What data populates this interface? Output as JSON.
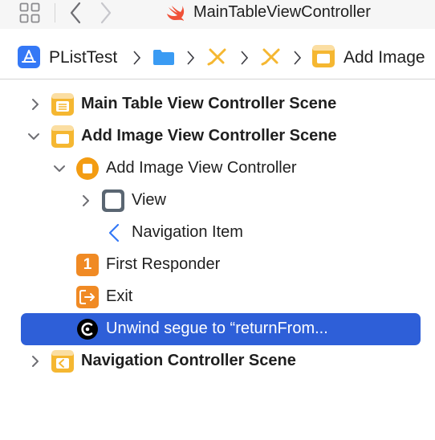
{
  "toolbar": {
    "file_tab_title": "MainTableViewController"
  },
  "breadcrumb": {
    "project": "PListTest",
    "last": "Add Image"
  },
  "outline": {
    "rows": [
      {
        "label": "Main Table View Controller Scene"
      },
      {
        "label": "Add Image View Controller Scene"
      },
      {
        "label": "Add Image View Controller"
      },
      {
        "label": "View"
      },
      {
        "label": "Navigation Item"
      },
      {
        "label": "First Responder"
      },
      {
        "label": "Exit"
      },
      {
        "label": "Unwind segue to “returnFrom..."
      },
      {
        "label": "Navigation Controller Scene"
      }
    ],
    "first_responder_badge": "1"
  },
  "colors": {
    "accent": "#2e5fd8",
    "scene_yellow": "#f5b731",
    "controller_orange": "#f39c12",
    "swift_orange": "#f05138",
    "folder_blue": "#3a9bf3",
    "project_blue": "#3478f6"
  }
}
